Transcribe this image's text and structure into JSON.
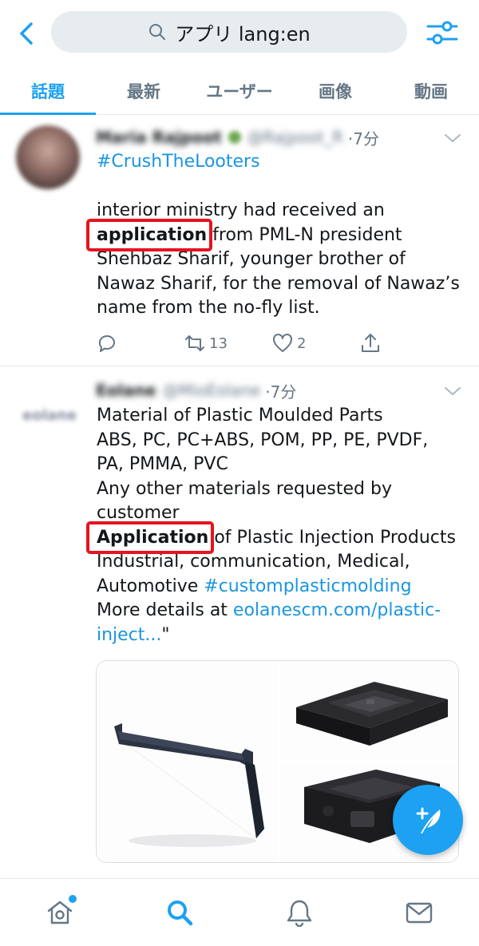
{
  "search": {
    "query": "アプリ lang:en"
  },
  "tabs": [
    {
      "label": "話題",
      "active": true
    },
    {
      "label": "最新",
      "active": false
    },
    {
      "label": "ユーザー",
      "active": false
    },
    {
      "label": "画像",
      "active": false
    },
    {
      "label": "動画",
      "active": false
    }
  ],
  "tweet1": {
    "name": "Maria Rajpoot",
    "handle": "@Rajpoot_R",
    "time": "·7分",
    "hashtag": "#CrushTheLooters",
    "line1": "interior ministry had received an",
    "highlight": "application",
    "line2_rest": " from PML-N president",
    "line3": "Shehbaz Sharif, younger brother of",
    "line4": "Nawaz Sharif, for the removal of Nawaz’s",
    "line5": "name from the no-fly list.",
    "retweets": "13",
    "likes": "2"
  },
  "tweet2": {
    "name": "Eolane",
    "handle": "@MioEolane",
    "avatar_text": "eolane",
    "time": "·7分",
    "line1": "Material of Plastic Moulded Parts",
    "line2": "ABS, PC, PC+ABS, POM, PP, PE, PVDF,",
    "line3": "PA, PMMA, PVC",
    "line4": "Any other materials requested by",
    "line5": "customer",
    "highlight": "Application",
    "line6_rest": " of Plastic Injection Products",
    "line7": "Industrial, communication, Medical,",
    "line8_prefix": "Automotive ",
    "line8_tag": "#customplasticmolding",
    "line9_prefix": "More details at ",
    "line9_link": "eolanescm.com/plastic-",
    "line10_link": "inject...",
    "line10_suffix": "\""
  },
  "colors": {
    "accent": "#1da1f2",
    "highlight_box": "#e5141f",
    "muted": "#657786"
  },
  "icons": [
    "back-icon",
    "search-icon",
    "filter-icon",
    "reply-icon",
    "retweet-icon",
    "like-icon",
    "share-icon",
    "compose-icon",
    "home-icon",
    "explore-icon",
    "notifications-icon",
    "messages-icon"
  ]
}
